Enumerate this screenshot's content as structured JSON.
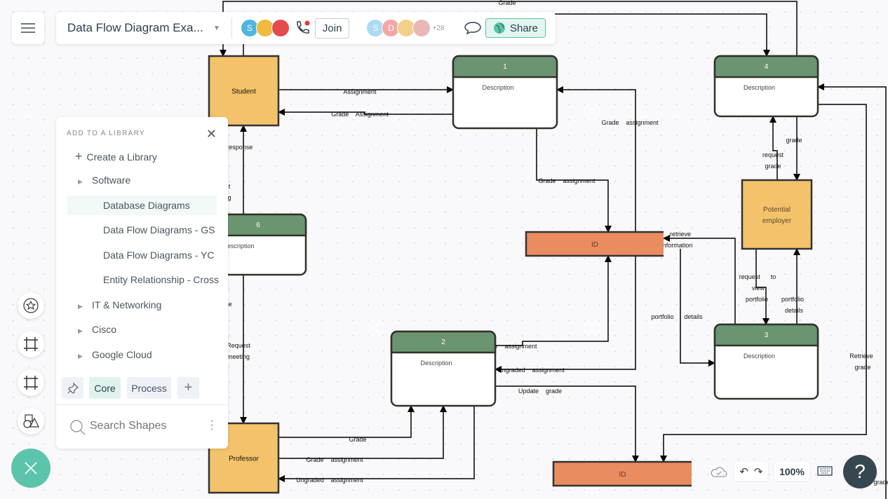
{
  "header": {
    "title": "Data Flow Diagram Exa...",
    "collaborators": [
      {
        "initial": "S",
        "color": "#4fb6e0"
      },
      {
        "initial": "",
        "color": "#f1b93e"
      },
      {
        "initial": "",
        "color": "#e54b4b"
      }
    ],
    "join_label": "Join",
    "viewers": [
      {
        "initial": "S",
        "color": "#a9dcf3"
      },
      {
        "initial": "D",
        "color": "#f4a6a6"
      },
      {
        "initial": "",
        "color": "#f1d08a"
      },
      {
        "initial": "",
        "color": "#e8b8b8"
      }
    ],
    "viewer_overflow": "+28",
    "share_label": "Share"
  },
  "library_panel": {
    "heading": "ADD TO A LIBRARY",
    "create_label": "Create a Library",
    "items": [
      {
        "label": "Software",
        "expandable": true
      },
      {
        "label": "Database Diagrams",
        "expandable": false,
        "highlighted": true
      },
      {
        "label": "Data Flow Diagrams - GS",
        "expandable": false
      },
      {
        "label": "Data Flow Diagrams - YC",
        "expandable": false
      },
      {
        "label": "Entity Relationship - Cross",
        "expandable": false
      },
      {
        "label": "IT & Networking",
        "expandable": true
      },
      {
        "label": "Cisco",
        "expandable": true
      },
      {
        "label": "Google Cloud",
        "expandable": true
      }
    ],
    "tabs": [
      {
        "label": "Core",
        "active": true
      },
      {
        "label": "Process",
        "active": false
      }
    ],
    "search_placeholder": "Search Shapes"
  },
  "bottom_bar": {
    "zoom": "100%"
  },
  "colors": {
    "entity": "#f3c26a",
    "process_header": "#6b9471",
    "data_store": "#e98c5f",
    "accent": "#5cc4ab"
  },
  "diagram": {
    "entities": [
      {
        "id": "student",
        "label": "Student"
      },
      {
        "id": "professor",
        "label": "Professor"
      },
      {
        "id": "employer",
        "label": "Potential employer"
      }
    ],
    "processes": [
      {
        "id": "p1",
        "number": "1",
        "text": "Description"
      },
      {
        "id": "p2",
        "number": "2",
        "text": "Description"
      },
      {
        "id": "p3",
        "number": "3",
        "text": "Description"
      },
      {
        "id": "p4",
        "number": "4",
        "text": "Description"
      },
      {
        "id": "p6",
        "number": "6",
        "text": "Description"
      }
    ],
    "stores": [
      {
        "id": "store-top",
        "label": "ID"
      },
      {
        "id": "store-bottom",
        "label": "ID"
      }
    ],
    "flows": [
      {
        "label": [
          "Assignment"
        ]
      },
      {
        "label": [
          "Grade    Assignment"
        ]
      },
      {
        "label": [
          "Grade"
        ]
      },
      {
        "label": []
      },
      {
        "label": [
          "Response",
          "t",
          "g"
        ]
      },
      {
        "label": [
          "se",
          "Request",
          "meeting"
        ]
      },
      {
        "label": [
          "Grade    assignment"
        ]
      },
      {
        "label": [
          "Grade    assignment"
        ]
      },
      {
        "label": [
          "Grade    assignment"
        ]
      },
      {
        "label": [
          "Ungraded    assignment"
        ]
      },
      {
        "label": [
          "Update    grade"
        ]
      },
      {
        "label": [
          "Grade"
        ]
      },
      {
        "label": [
          "Grade    assignment"
        ]
      },
      {
        "label": [
          "Ungraded    assignment"
        ]
      },
      {
        "label": [
          "Retrieve",
          "grade"
        ]
      },
      {
        "label": [
          "grade"
        ]
      },
      {
        "label": [
          "request",
          "grade"
        ]
      },
      {
        "label": [
          "grade"
        ]
      },
      {
        "label": [
          "retrieve",
          "information"
        ]
      },
      {
        "label": [
          "portfolio      details"
        ]
      },
      {
        "label": [
          "request      to",
          "view",
          "portfolio"
        ]
      },
      {
        "label": [
          "portfolio",
          "details"
        ]
      }
    ]
  }
}
